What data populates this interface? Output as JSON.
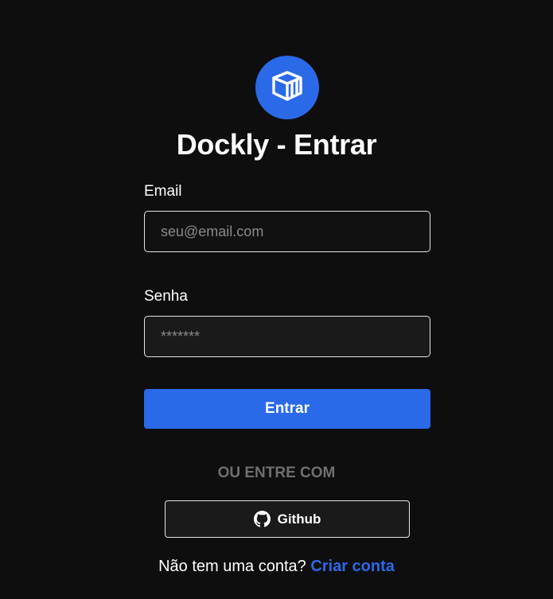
{
  "logo": {
    "icon": "container-box-icon",
    "bg_color": "#2a6ae8"
  },
  "title": "Dockly - Entrar",
  "form": {
    "email_label": "Email",
    "email_placeholder": "seu@email.com",
    "email_value": "",
    "password_label": "Senha",
    "password_placeholder": "*******",
    "password_value": "",
    "submit_label": "Entrar"
  },
  "divider": "OU ENTRE COM",
  "github": {
    "label": "Github",
    "icon": "github-icon"
  },
  "signup": {
    "prompt": "Não tem uma conta?",
    "link_label": "Criar conta"
  },
  "colors": {
    "background": "#0e0e0e",
    "accent": "#2a6ae8",
    "muted": "#6f6f6f"
  }
}
